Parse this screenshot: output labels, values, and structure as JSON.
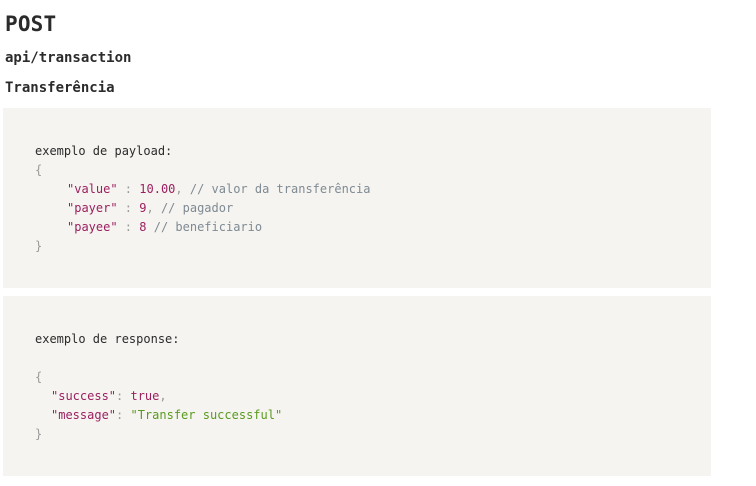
{
  "method": "POST",
  "endpoint": "api/transaction",
  "description": "Transferência",
  "payload_example": {
    "label": "exemplo de payload:",
    "open_brace": "{",
    "close_brace": "}",
    "fields": [
      {
        "key": "\"value\"",
        "sep": " : ",
        "value": "10.00",
        "trail": ",",
        "comment": " // valor da transferência"
      },
      {
        "key": "\"payer\"",
        "sep": " : ",
        "value": "9",
        "trail": ",",
        "comment": " // pagador"
      },
      {
        "key": "\"payee\"",
        "sep": " : ",
        "value": "8",
        "trail": "",
        "comment": " // beneficiario"
      }
    ]
  },
  "response_example": {
    "label": "exemplo de response:",
    "open_brace": "{",
    "close_brace": "}",
    "fields": [
      {
        "key": "\"success\"",
        "sep": ": ",
        "value": "true",
        "trail": ","
      },
      {
        "key": "\"message\"",
        "sep": ": ",
        "value": "\"Transfer successful\"",
        "trail": ""
      }
    ]
  }
}
